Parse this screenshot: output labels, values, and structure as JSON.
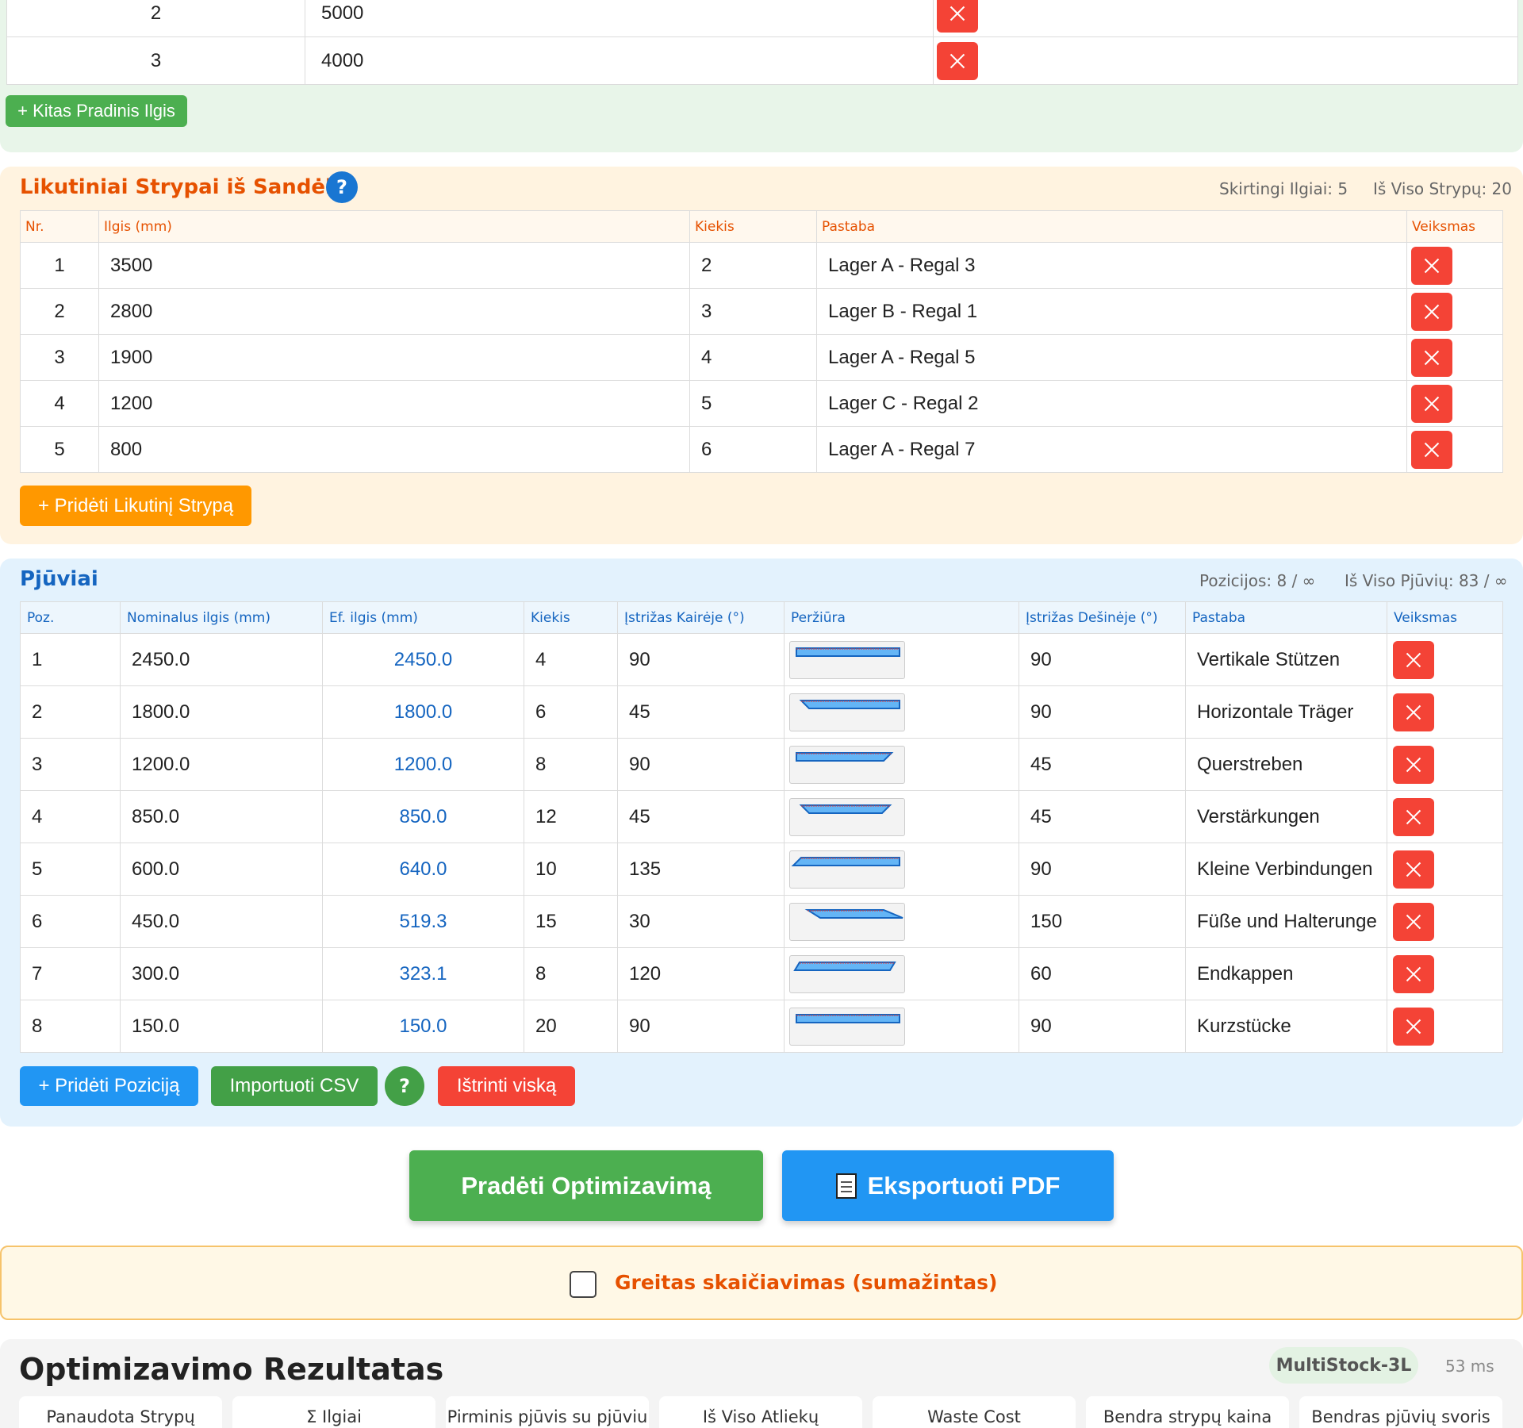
{
  "primary_lengths": {
    "rows": [
      {
        "nr": "2",
        "length": "5000"
      },
      {
        "nr": "3",
        "length": "4000"
      }
    ],
    "add_button": "+ Kitas Pradinis Ilgis"
  },
  "stock": {
    "title": "Likutiniai Strypai iš Sandėlio",
    "help": "?",
    "stat_distinct": "Skirtingi Ilgiai: 5",
    "stat_total": "Iš Viso Strypų: 20",
    "headers": [
      "Nr.",
      "Ilgis (mm)",
      "Kiekis",
      "Pastaba",
      "Veiksmas"
    ],
    "rows": [
      {
        "nr": "1",
        "length": "3500",
        "qty": "2",
        "note": "Lager A - Regal 3"
      },
      {
        "nr": "2",
        "length": "2800",
        "qty": "3",
        "note": "Lager B - Regal 1"
      },
      {
        "nr": "3",
        "length": "1900",
        "qty": "4",
        "note": "Lager A - Regal 5"
      },
      {
        "nr": "4",
        "length": "1200",
        "qty": "5",
        "note": "Lager C - Regal 2"
      },
      {
        "nr": "5",
        "length": "800",
        "qty": "6",
        "note": "Lager A - Regal 7"
      }
    ],
    "add_button": "+ Pridėti Likutinį Strypą"
  },
  "cuts": {
    "title": "Pjūviai",
    "stat_positions": "Pozicijos: 8 / ∞",
    "stat_total": "Iš Viso Pjūvių: 83 / ∞",
    "headers": [
      "Poz.",
      "Nominalus ilgis (mm)",
      "Ef. ilgis (mm)",
      "Kiekis",
      "Įstrižas Kairėje (°)",
      "Peržiūra",
      "Įstrižas Dešinėje (°)",
      "Pastaba",
      "Veiksmas"
    ],
    "rows": [
      {
        "pos": "1",
        "nominal": "2450.0",
        "effective": "2450.0",
        "qty": "4",
        "left_angle": "90",
        "right_angle": "90",
        "note": "Vertikale Stützen"
      },
      {
        "pos": "2",
        "nominal": "1800.0",
        "effective": "1800.0",
        "qty": "6",
        "left_angle": "45",
        "right_angle": "90",
        "note": "Horizontale Träger"
      },
      {
        "pos": "3",
        "nominal": "1200.0",
        "effective": "1200.0",
        "qty": "8",
        "left_angle": "90",
        "right_angle": "45",
        "note": "Querstreben"
      },
      {
        "pos": "4",
        "nominal": "850.0",
        "effective": "850.0",
        "qty": "12",
        "left_angle": "45",
        "right_angle": "45",
        "note": "Verstärkungen"
      },
      {
        "pos": "5",
        "nominal": "600.0",
        "effective": "640.0",
        "qty": "10",
        "left_angle": "135",
        "right_angle": "90",
        "note": "Kleine Verbindungen"
      },
      {
        "pos": "6",
        "nominal": "450.0",
        "effective": "519.3",
        "qty": "15",
        "left_angle": "30",
        "right_angle": "150",
        "note": "Füße und Halterunge"
      },
      {
        "pos": "7",
        "nominal": "300.0",
        "effective": "323.1",
        "qty": "8",
        "left_angle": "120",
        "right_angle": "60",
        "note": "Endkappen"
      },
      {
        "pos": "8",
        "nominal": "150.0",
        "effective": "150.0",
        "qty": "20",
        "left_angle": "90",
        "right_angle": "90",
        "note": "Kurzstücke"
      }
    ],
    "add_button": "+ Pridėti Poziciją",
    "import_button": "Importuoti CSV",
    "help": "?",
    "clear_button": "Ištrinti viską"
  },
  "actions": {
    "start": "Pradėti Optimizavimą",
    "export": "Eksportuoti PDF"
  },
  "quick_calc": {
    "label": "Greitas skaičiavimas (sumažintas)",
    "checked": false
  },
  "results": {
    "title": "Optimizavimo Rezultatas",
    "algorithm": "MultiStock-3L",
    "time": "53 ms",
    "cards": [
      "Panaudota Strypų",
      "Σ Ilgiai",
      "Pirminis pjūvis su pjūviu",
      "Iš Viso Atliekų",
      "Waste Cost",
      "Bendra strypų kaina",
      "Bendras pjūvių svoris"
    ]
  },
  "colors": {
    "green": "#4caf50",
    "orange": "#ff9800",
    "blue": "#2196f3",
    "red": "#f44336",
    "stock_title": "#e65100",
    "cuts_title": "#1565c0"
  }
}
